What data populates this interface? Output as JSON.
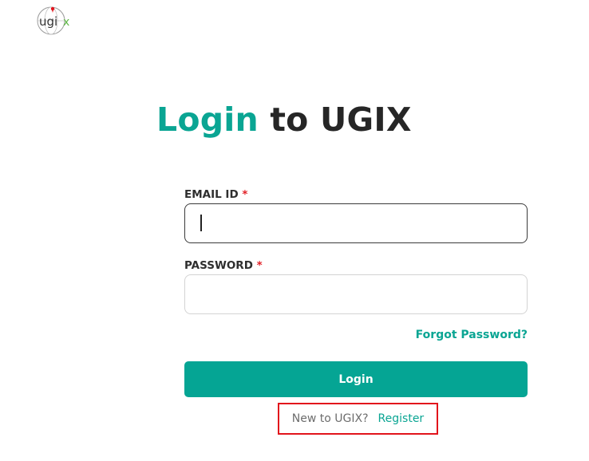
{
  "logo": {
    "text": "ugix",
    "icon": "globe-pin-icon",
    "colors": {
      "text": "#333333",
      "pin": "#e2141c",
      "x": "#5fb847"
    }
  },
  "heading": {
    "accent": "Login",
    "rest": "to UGIX"
  },
  "form": {
    "email": {
      "label": "EMAIL ID",
      "required_mark": "*",
      "value": "",
      "focused": true
    },
    "password": {
      "label": "PASSWORD",
      "required_mark": "*",
      "value": ""
    },
    "forgot_password": "Forgot Password?",
    "submit_label": "Login"
  },
  "register": {
    "prompt": "New to UGIX?",
    "link": "Register"
  },
  "colors": {
    "accent": "#0aa593",
    "button": "#05a594",
    "required": "#e21f26",
    "highlight_box": "#e2141c"
  }
}
